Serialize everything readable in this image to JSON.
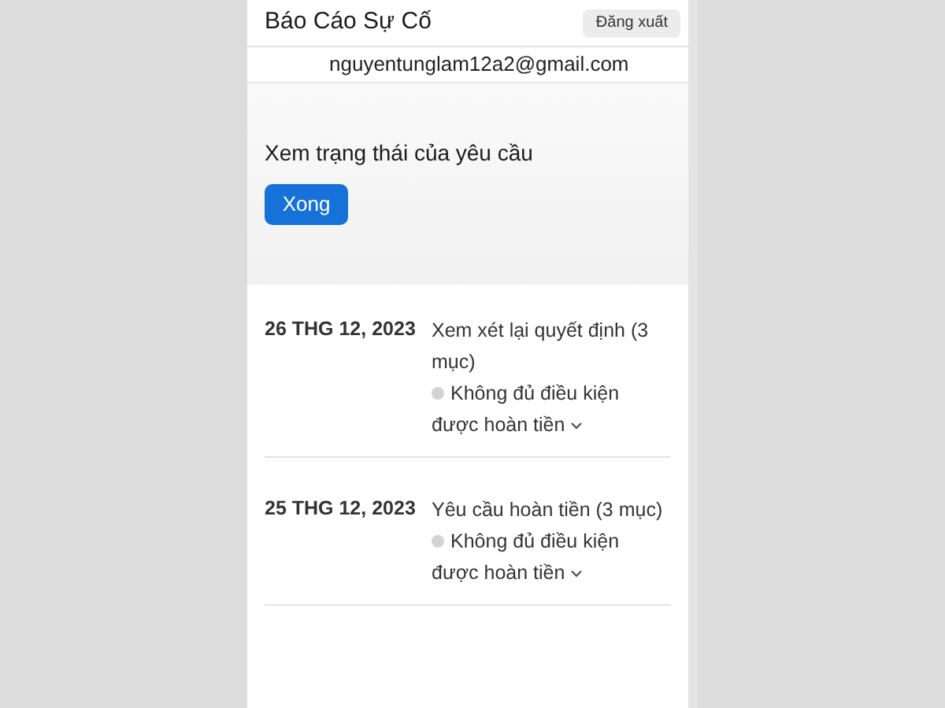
{
  "header": {
    "title": "Báo Cáo Sự Cố",
    "logout_button": "Đăng xuất"
  },
  "account": {
    "email": "nguyentunglam12a2@gmail.com"
  },
  "status_section": {
    "heading": "Xem trạng thái của yêu cầu",
    "done_button": "Xong"
  },
  "requests": [
    {
      "date": "26 THG 12, 2023",
      "title": "Xem xét lại quyết định (3 mục)",
      "status": "Không đủ điều kiện được hoàn tiền"
    },
    {
      "date": "25 THG 12, 2023",
      "title": "Yêu cầu hoàn tiền (3 mục)",
      "status": "Không đủ điều kiện được hoàn tiền"
    }
  ]
}
